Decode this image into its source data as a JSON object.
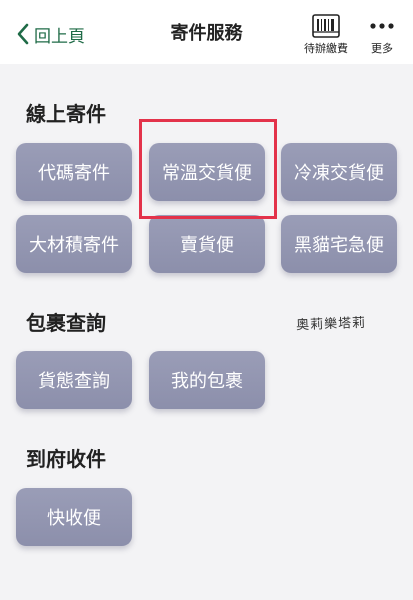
{
  "header": {
    "back_label": "回上頁",
    "title": "寄件服務",
    "pending_label": "待辦繳費",
    "more_label": "更多",
    "back_icon": "chevron-left-icon",
    "pending_icon": "barcode-icon",
    "more_icon": "more-dots-icon"
  },
  "sections": [
    {
      "title": "線上寄件",
      "buttons": [
        "代碼寄件",
        "常溫交貨便",
        "冷凍交貨便",
        "大材積寄件",
        "賣貨便",
        "黑貓宅急便"
      ]
    },
    {
      "title": "包裹查詢",
      "buttons": [
        "貨態查詢",
        "我的包裹"
      ]
    },
    {
      "title": "到府收件",
      "buttons": [
        "快收便"
      ]
    }
  ],
  "watermark": "奧莉樂塔莉",
  "colors": {
    "accent": "#1f6b47",
    "button": "#9a9db7",
    "highlight": "#e3324a",
    "background": "#f3f3f5"
  }
}
